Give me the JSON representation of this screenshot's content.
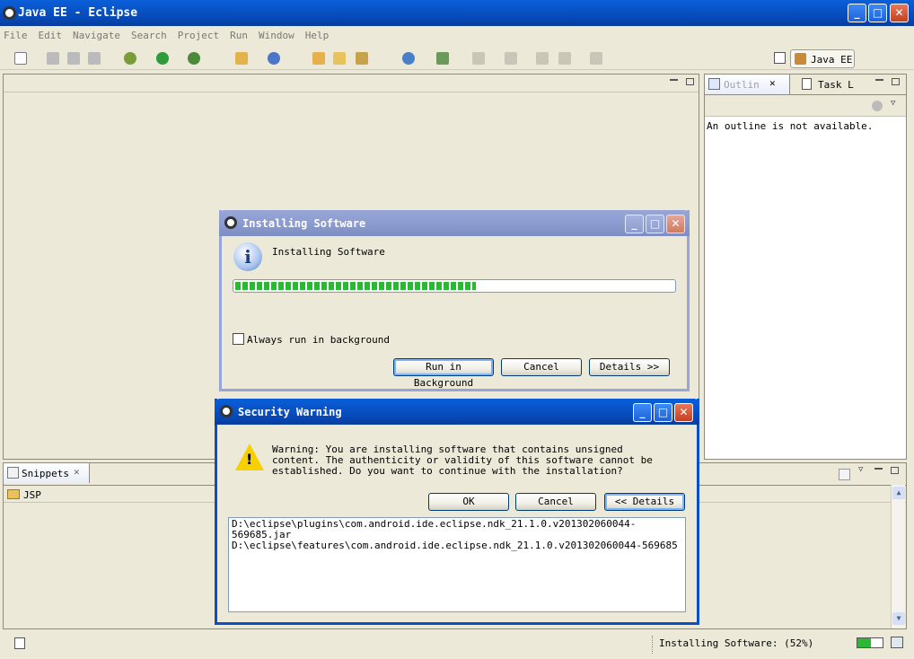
{
  "window": {
    "title": "Java EE - Eclipse"
  },
  "menu": [
    "File",
    "Edit",
    "Navigate",
    "Search",
    "Project",
    "Run",
    "Window",
    "Help"
  ],
  "perspective": {
    "label": "Java EE"
  },
  "outline": {
    "tabs": [
      {
        "label": "Outlin"
      },
      {
        "label": "Task L"
      }
    ],
    "message": "An outline is not available."
  },
  "snippets": {
    "tab_label": "Snippets",
    "item": "JSP"
  },
  "install_dialog": {
    "title": "Installing Software",
    "message": "Installing Software",
    "progress": 0.55,
    "checkbox_label": "Always run in background",
    "checkbox_checked": false,
    "buttons": {
      "background": "Run in Background",
      "cancel": "Cancel",
      "details": "Details >>"
    }
  },
  "security_dialog": {
    "title": "Security Warning",
    "message": "Warning: You are installing software that contains unsigned content. The authenticity or validity of this software cannot be established. Do you want to continue with the installation?",
    "buttons": {
      "ok": "OK",
      "cancel": "Cancel",
      "details": "<< Details"
    },
    "details": [
      "D:\\eclipse\\plugins\\com.android.ide.eclipse.ndk_21.1.0.v201302060044-569685.jar",
      "D:\\eclipse\\features\\com.android.ide.eclipse.ndk_21.1.0.v201302060044-569685"
    ]
  },
  "statusbar": {
    "text": "Installing Software:  (52%)",
    "progress": 0.52
  },
  "colors": {
    "progress_green": "#2bb834",
    "title_blue": "#0a5fd8",
    "warning_yellow": "#f7d000"
  }
}
